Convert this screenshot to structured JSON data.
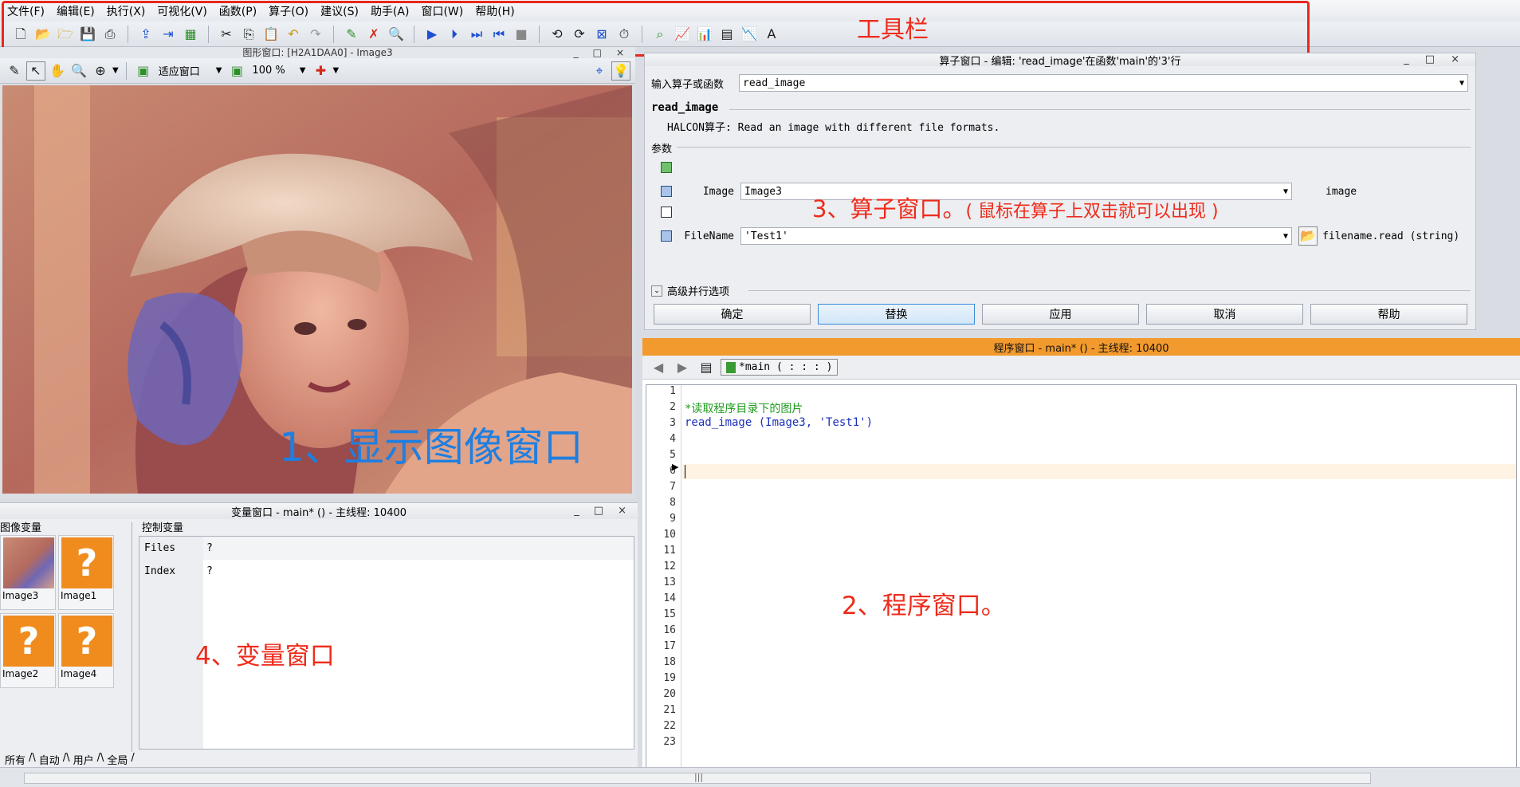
{
  "menubar": {
    "items": [
      "文件(F)",
      "编辑(E)",
      "执行(X)",
      "可视化(V)",
      "函数(P)",
      "算子(O)",
      "建议(S)",
      "助手(A)",
      "窗口(W)",
      "帮助(H)"
    ]
  },
  "annotations": {
    "toolbar": "工具栏",
    "graphics": "1、显示图像窗口",
    "program": "2、程序窗口。",
    "operator": "3、算子窗口。",
    "operator_hint": "( 鼠标在算子上双击就可以出现 )",
    "variable": "4、变量窗口"
  },
  "colors": {
    "annotation_red": "#ee2b1b",
    "graphics_annotation_blue": "#1f7fe0",
    "program_title_orange": "#f29a2e",
    "thumb_orange": "#f08c1e"
  },
  "graphics_window": {
    "title": "图形窗口: [H2A1DAA0] - Image3",
    "zoom_fit": "适应窗口",
    "zoom_percent": "100 %"
  },
  "operator_window": {
    "title": "算子窗口 - 编辑: 'read_image'在函数'main'的'3'行",
    "input_label": "输入算子或函数",
    "input_value": "read_image",
    "op_name": "read_image",
    "op_desc": "HALCON算子: Read an image with different file formats.",
    "params_label": "参数",
    "params": [
      {
        "name": "Image",
        "value": "Image3",
        "type": "image"
      },
      {
        "name": "FileName",
        "value": "'Test1'",
        "type": "filename.read (string)"
      }
    ],
    "advanced": "高级并行选项",
    "buttons": [
      "确定",
      "替换",
      "应用",
      "取消",
      "帮助"
    ]
  },
  "program_window": {
    "title": "程序窗口 - main* () - 主线程: 10400",
    "proc_tab": "*main ( : : : )",
    "lines": [
      "",
      "*读取程序目录下的图片",
      "read_image (Image3, 'Test1')",
      "",
      "",
      "",
      "",
      "",
      "",
      "",
      "",
      "",
      "",
      "",
      "",
      "",
      "",
      "",
      "",
      "",
      "",
      "",
      ""
    ],
    "code_comment": "*读取程序目录下的图片",
    "code_op": "read_image",
    "code_args": " (Image3, 'Test1')",
    "line_numbers": [
      "1",
      "2",
      "3",
      "4",
      "5",
      "6",
      "7",
      "8",
      "9",
      "10",
      "11",
      "12",
      "13",
      "14",
      "15",
      "16",
      "17",
      "18",
      "19",
      "20",
      "21",
      "22",
      "23"
    ]
  },
  "variable_window": {
    "title": "变量窗口 - main* () - 主线程: 10400",
    "iconic_label": "图像变量",
    "control_label": "控制变量",
    "iconic": [
      "Image3",
      "Image1",
      "Image2",
      "Image4"
    ],
    "control": [
      {
        "name": "Files",
        "value": "?"
      },
      {
        "name": "Index",
        "value": "?"
      }
    ],
    "tabs": [
      "所有",
      "自动",
      "用户",
      "全局"
    ]
  },
  "window_controls": {
    "minimize": "_",
    "maximize": "□",
    "close": "×"
  }
}
